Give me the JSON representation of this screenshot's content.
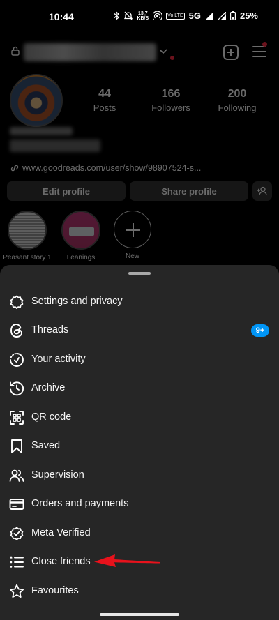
{
  "status_bar": {
    "time": "10:44",
    "net_speed_value": "13.7",
    "net_speed_unit": "KB/S",
    "volte": "Vo LTE",
    "network": "5G",
    "battery": "25%"
  },
  "profile": {
    "stats": [
      {
        "value": "44",
        "label": "Posts"
      },
      {
        "value": "166",
        "label": "Followers"
      },
      {
        "value": "200",
        "label": "Following"
      }
    ],
    "link": "www.goodreads.com/user/show/98907524-s...",
    "edit_profile_label": "Edit profile",
    "share_profile_label": "Share profile",
    "highlights": [
      {
        "label": "Peasant story 1"
      },
      {
        "label": "Leanings"
      },
      {
        "label": "New"
      }
    ]
  },
  "menu": {
    "items": [
      {
        "label": "Settings and privacy",
        "icon": "settings-icon"
      },
      {
        "label": "Threads",
        "icon": "threads-icon",
        "badge": "9+"
      },
      {
        "label": "Your activity",
        "icon": "activity-icon"
      },
      {
        "label": "Archive",
        "icon": "archive-icon"
      },
      {
        "label": "QR code",
        "icon": "qr-code-icon"
      },
      {
        "label": "Saved",
        "icon": "bookmark-icon"
      },
      {
        "label": "Supervision",
        "icon": "supervision-icon"
      },
      {
        "label": "Orders and payments",
        "icon": "card-icon"
      },
      {
        "label": "Meta Verified",
        "icon": "verified-icon"
      },
      {
        "label": "Close friends",
        "icon": "close-friends-icon"
      },
      {
        "label": "Favourites",
        "icon": "star-icon"
      }
    ]
  },
  "colors": {
    "sheet_bg": "#262626",
    "badge_blue": "#0095f6",
    "annotation_red": "#e8121c",
    "notification_red": "#ff2d44"
  }
}
